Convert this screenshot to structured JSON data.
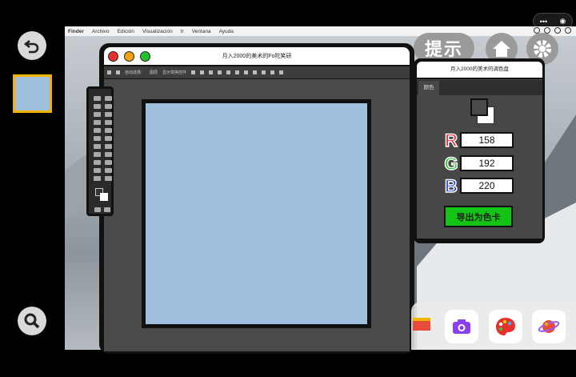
{
  "colors": {
    "accent_border": "#f2b400",
    "canvas": "#9fc1de",
    "export_green": "#14c414",
    "R": "#e01030",
    "G": "#18c018",
    "B": "#1838e0"
  },
  "menubar": {
    "items": [
      "Finder",
      "Archivo",
      "Edición",
      "Visualización",
      "Ir",
      "Ventana",
      "Ayuda"
    ]
  },
  "hint_label": "提示",
  "ps_window": {
    "title": "月入2000的美术的Fo陀笑研",
    "options": [
      "自动选择：",
      "图层",
      "显示变换控件"
    ]
  },
  "color_panel": {
    "title": "月入2000的美术的调色盘",
    "tab": "颜色",
    "r_label": "R",
    "g_label": "G",
    "b_label": "B",
    "r": "158",
    "g": "192",
    "b": "220",
    "export_label": "导出为色卡"
  },
  "icons": [
    "back-icon",
    "search-icon",
    "home-icon",
    "gear-icon",
    "camera-icon",
    "palette-icon",
    "planet-icon",
    "more-icon",
    "record-icon"
  ]
}
